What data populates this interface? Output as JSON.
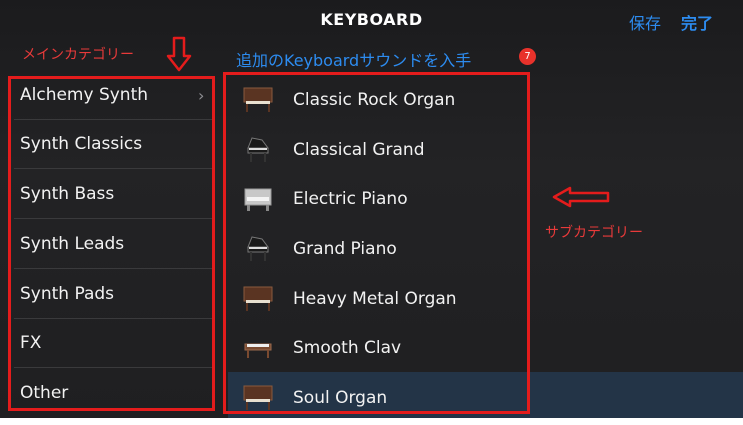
{
  "header": {
    "title": "KEYBOARD",
    "save_label": "保存",
    "done_label": "完了"
  },
  "annotations": {
    "main_category": "メインカテゴリー",
    "sub_category": "サブカテゴリー",
    "color": "#e41c1c"
  },
  "more_sounds": {
    "label": "追加のKeyboardサウンドを入手",
    "badge": "7"
  },
  "sidebar": {
    "items": [
      {
        "label": "Alchemy Synth",
        "has_chevron": true
      },
      {
        "label": "Synth Classics"
      },
      {
        "label": "Synth Bass"
      },
      {
        "label": "Synth Leads"
      },
      {
        "label": "Synth Pads"
      },
      {
        "label": "FX"
      },
      {
        "label": "Other"
      }
    ],
    "chevron": "›"
  },
  "instruments": {
    "items": [
      {
        "label": "Classic Rock Organ",
        "icon": "organ-icon"
      },
      {
        "label": "Classical Grand",
        "icon": "grand-piano-icon"
      },
      {
        "label": "Electric Piano",
        "icon": "electric-piano-icon"
      },
      {
        "label": "Grand Piano",
        "icon": "grand-piano-icon"
      },
      {
        "label": "Heavy Metal Organ",
        "icon": "organ-icon"
      },
      {
        "label": "Smooth Clav",
        "icon": "clavinet-icon"
      },
      {
        "label": "Soul Organ",
        "icon": "organ-icon",
        "selected": true
      }
    ]
  },
  "colors": {
    "accent": "#2d8cf0",
    "selected_row": "#233447",
    "badge": "#e8322b"
  }
}
